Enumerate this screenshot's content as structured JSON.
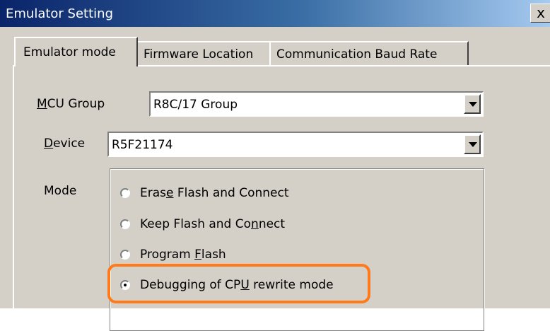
{
  "window": {
    "title": "Emulator Setting",
    "close_label": "x"
  },
  "tabs": [
    {
      "label": "Emulator mode"
    },
    {
      "label": "Firmware Location"
    },
    {
      "label": "Communication Baud Rate"
    }
  ],
  "mcu_group": {
    "label_key": "M",
    "label_rest": "CU Group",
    "value": "R8C/17 Group"
  },
  "device": {
    "label_key": "D",
    "label_rest": "evice",
    "value": "R5F21174"
  },
  "mode": {
    "label": "Mode",
    "options": [
      {
        "pre": "Eras",
        "key": "e",
        "post": " Flash and Connect",
        "selected": false
      },
      {
        "pre": "Keep Flash and Co",
        "key": "n",
        "post": "nect",
        "selected": false
      },
      {
        "pre": "Program ",
        "key": "F",
        "post": "lash",
        "selected": false
      },
      {
        "pre": "Debugging of CP",
        "key": "U",
        "post": " rewrite mode",
        "selected": true
      }
    ]
  },
  "highlight_color": "#ff7a1a"
}
